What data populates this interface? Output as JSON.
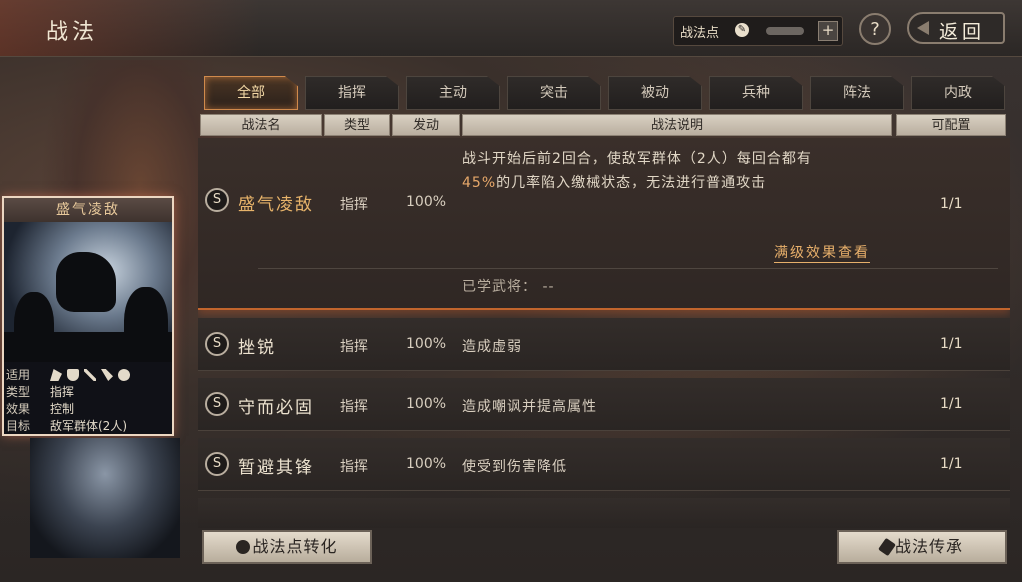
{
  "header": {
    "title": "战法",
    "points_label": "战法点",
    "plus_label": "+",
    "help_label": "?",
    "back_label": "返回"
  },
  "tabs": [
    {
      "label": "全部",
      "active": true
    },
    {
      "label": "指挥",
      "active": false
    },
    {
      "label": "主动",
      "active": false
    },
    {
      "label": "突击",
      "active": false
    },
    {
      "label": "被动",
      "active": false
    },
    {
      "label": "兵种",
      "active": false
    },
    {
      "label": "阵法",
      "active": false
    },
    {
      "label": "内政",
      "active": false
    }
  ],
  "columns": {
    "name": "战法名",
    "type": "类型",
    "rate": "发动",
    "desc": "战法说明",
    "slots": "可配置"
  },
  "selected": {
    "grade": "S",
    "name": "盛气凌敌",
    "type": "指挥",
    "rate": "100%",
    "desc_line1": "战斗开始后前2回合，使敌军群体（2人）每回合都有",
    "desc_line2_hl": "45%",
    "desc_line2_rest": "的几率陷入缴械状态，无法进行普通攻击",
    "slots": "1/1",
    "max_effect_link": "满级效果查看",
    "learned_label": "已学武将：",
    "learned_value": "--"
  },
  "rows": [
    {
      "grade": "S",
      "name": "挫锐",
      "type": "指挥",
      "rate": "100%",
      "desc": "造成虚弱",
      "slots": "1/1"
    },
    {
      "grade": "S",
      "name": "守而必固",
      "type": "指挥",
      "rate": "100%",
      "desc": "造成嘲讽并提高属性",
      "slots": "1/1"
    },
    {
      "grade": "S",
      "name": "暂避其锋",
      "type": "指挥",
      "rate": "100%",
      "desc": "使受到伤害降低",
      "slots": "1/1"
    }
  ],
  "card": {
    "title": "盛气凌敌",
    "applicable_key": "适用",
    "type_key": "类型",
    "type_value": "指挥",
    "effect_key": "效果",
    "effect_value": "控制",
    "target_key": "目标",
    "target_value": "敌军群体(2人)",
    "unit_icons": [
      "cavalry-icon",
      "shield-icon",
      "bow-icon",
      "spear-icon",
      "siege-icon"
    ]
  },
  "buttons": {
    "convert": "战法点转化",
    "inherit": "战法传承"
  },
  "colors": {
    "accent_orange": "#d08a4c",
    "highlight": "#e7a86a",
    "link": "#e8b06b"
  }
}
